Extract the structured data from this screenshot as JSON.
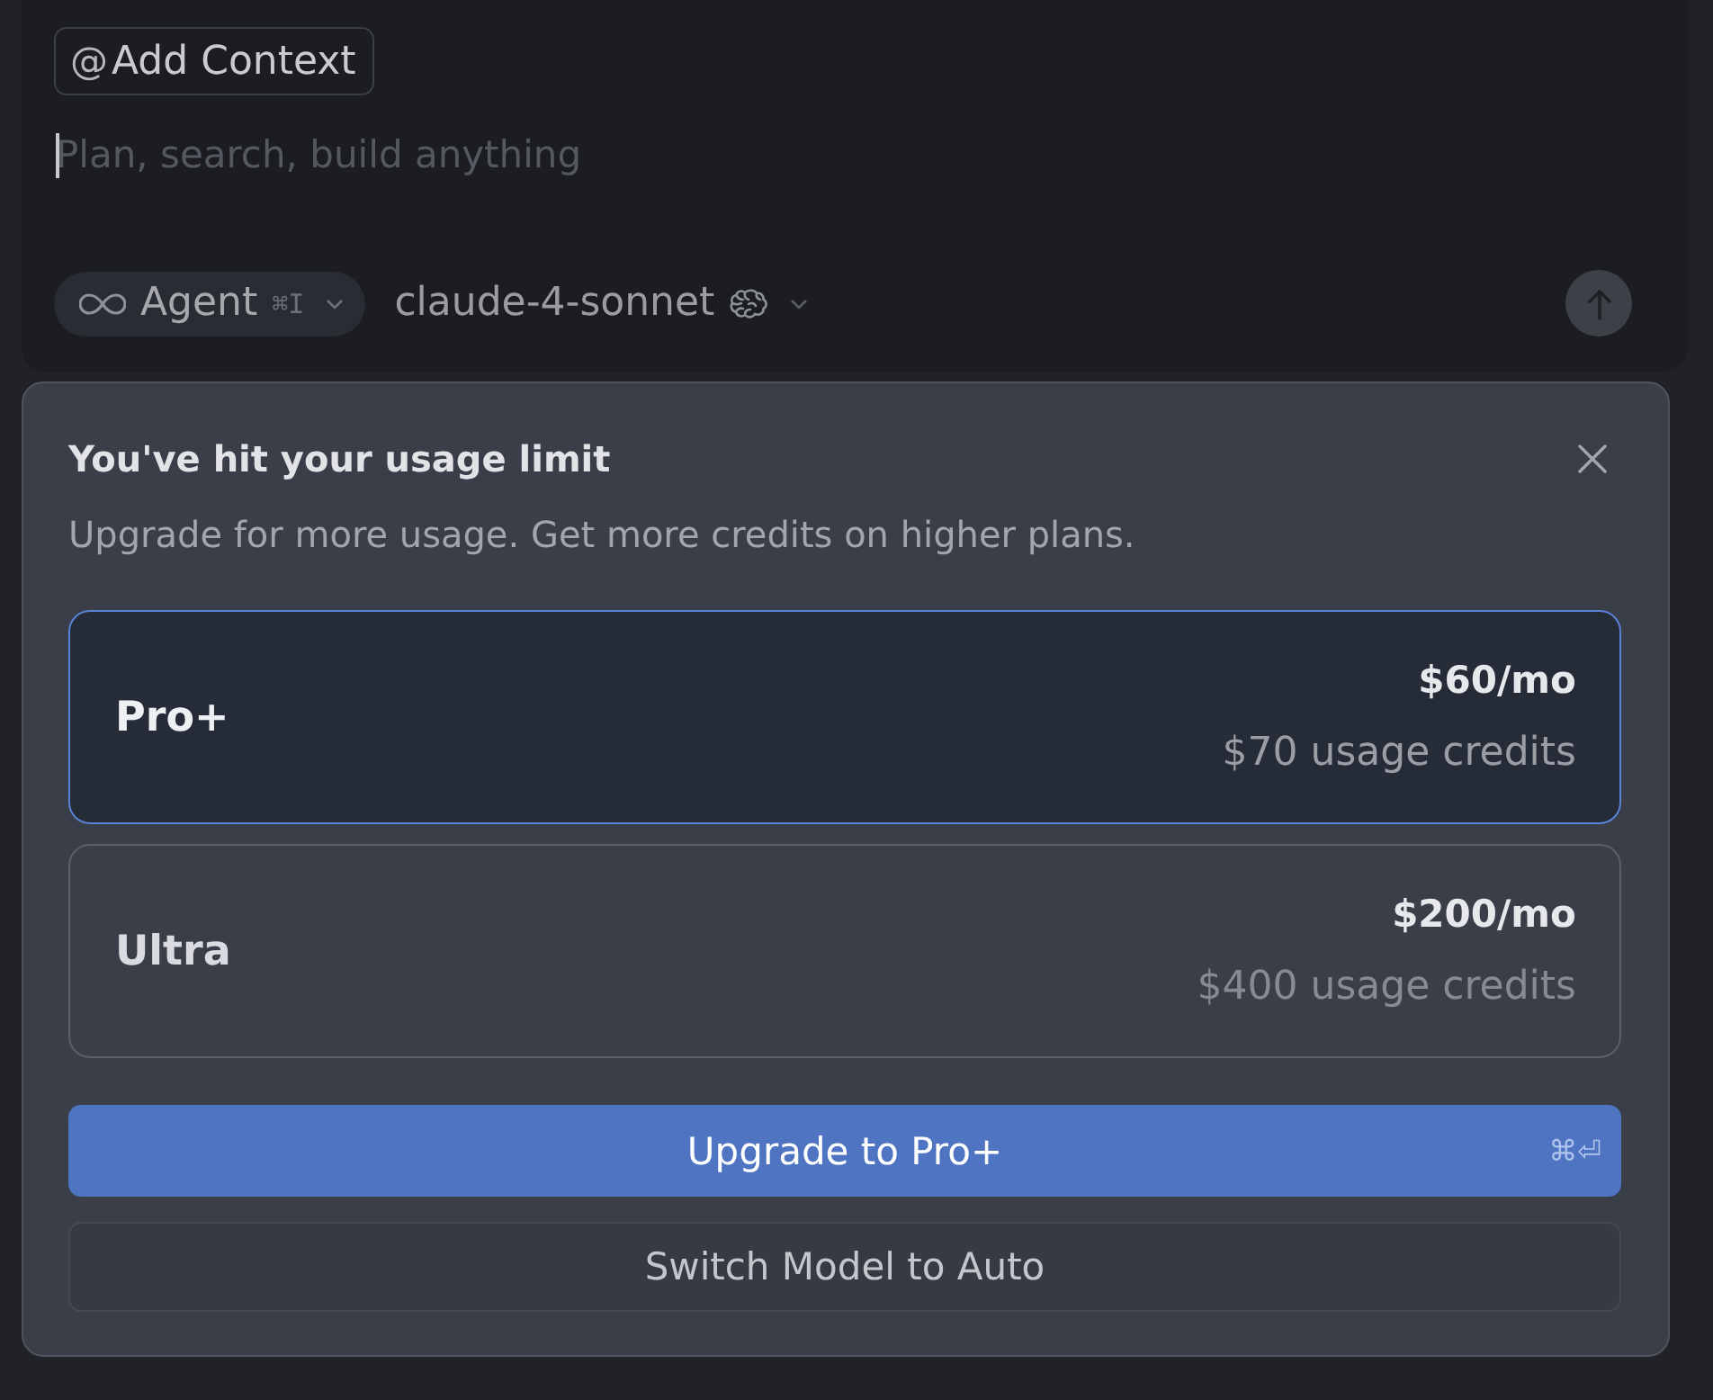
{
  "composer": {
    "add_context": {
      "icon": "@",
      "label": "Add Context"
    },
    "input": {
      "placeholder": "Plan, search, build anything",
      "focused": true
    },
    "mode": {
      "label": "Agent",
      "shortcut": "⌘I"
    },
    "model": {
      "label": "claude-4-sonnet"
    },
    "send": {
      "disabled": true
    }
  },
  "dialog": {
    "title": "You've hit your usage limit",
    "subtitle": "Upgrade for more usage. Get more credits on higher plans.",
    "plans": [
      {
        "name": "Pro+",
        "price": "$60/mo",
        "credits": "$70 usage credits",
        "selected": true
      },
      {
        "name": "Ultra",
        "price": "$200/mo",
        "credits": "$400 usage credits",
        "selected": false
      }
    ],
    "primary_button": {
      "label": "Upgrade to Pro+",
      "shortcut": "⌘⏎"
    },
    "secondary_button": {
      "label": "Switch Model to Auto"
    }
  }
}
